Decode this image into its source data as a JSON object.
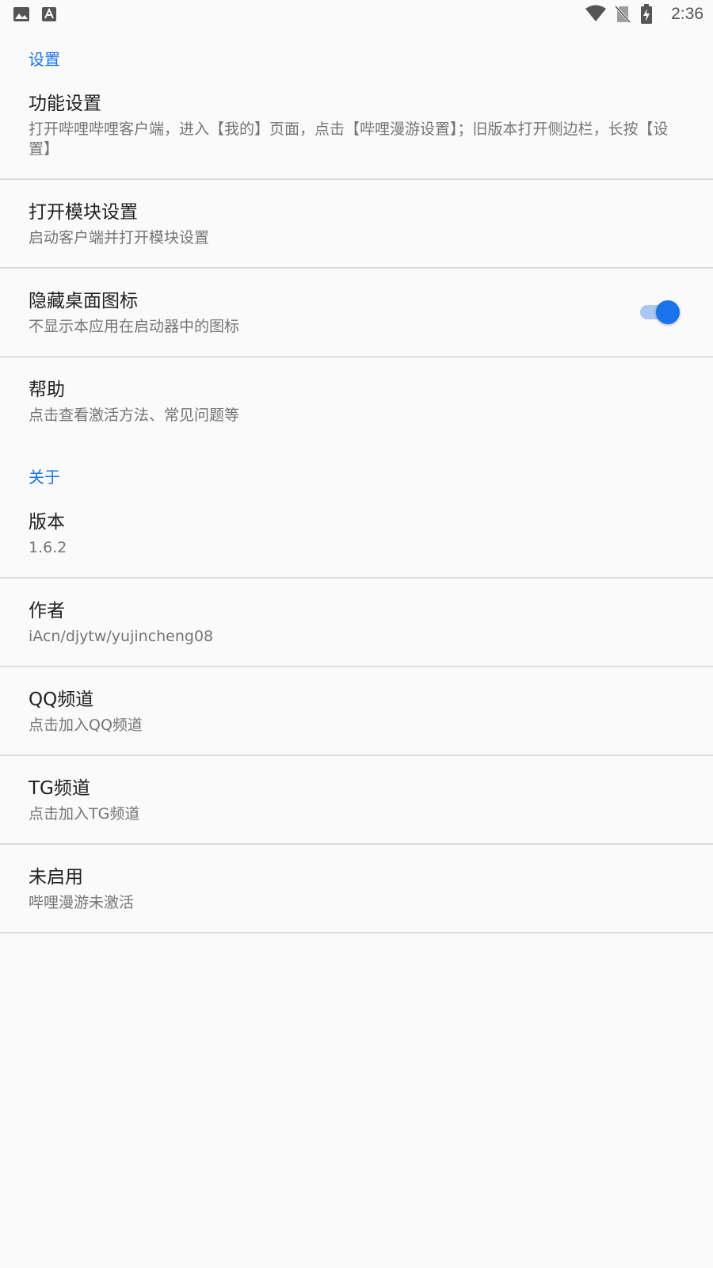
{
  "status_bar": {
    "time": "2:36",
    "icons": [
      "image-icon",
      "font-icon",
      "wifi-icon",
      "no-sim-icon",
      "battery-charging-icon"
    ]
  },
  "colors": {
    "accent": "#1a73e8",
    "title_text": "#202020",
    "summary_text": "#757575",
    "background": "#fafafa",
    "divider": "#dcdcdc"
  },
  "sections": {
    "settings": {
      "title": "设置",
      "items": [
        {
          "title": "功能设置",
          "summary": "打开哔哩哔哩客户端，进入【我的】页面，点击【哔哩漫游设置】；旧版本打开侧边栏，长按【设置】"
        },
        {
          "title": "打开模块设置",
          "summary": "启动客户端并打开模块设置"
        },
        {
          "title": "隐藏桌面图标",
          "summary": "不显示本应用在启动器中的图标",
          "switch_on": true
        },
        {
          "title": "帮助",
          "summary": "点击查看激活方法、常见问题等"
        }
      ]
    },
    "about": {
      "title": "关于",
      "items": [
        {
          "title": "版本",
          "summary": "1.6.2"
        },
        {
          "title": "作者",
          "summary": "iAcn/djytw/yujincheng08"
        },
        {
          "title": "QQ频道",
          "summary": "点击加入QQ频道"
        },
        {
          "title": "TG频道",
          "summary": "点击加入TG频道"
        },
        {
          "title": "未启用",
          "summary": "哔哩漫游未激活"
        }
      ]
    }
  }
}
